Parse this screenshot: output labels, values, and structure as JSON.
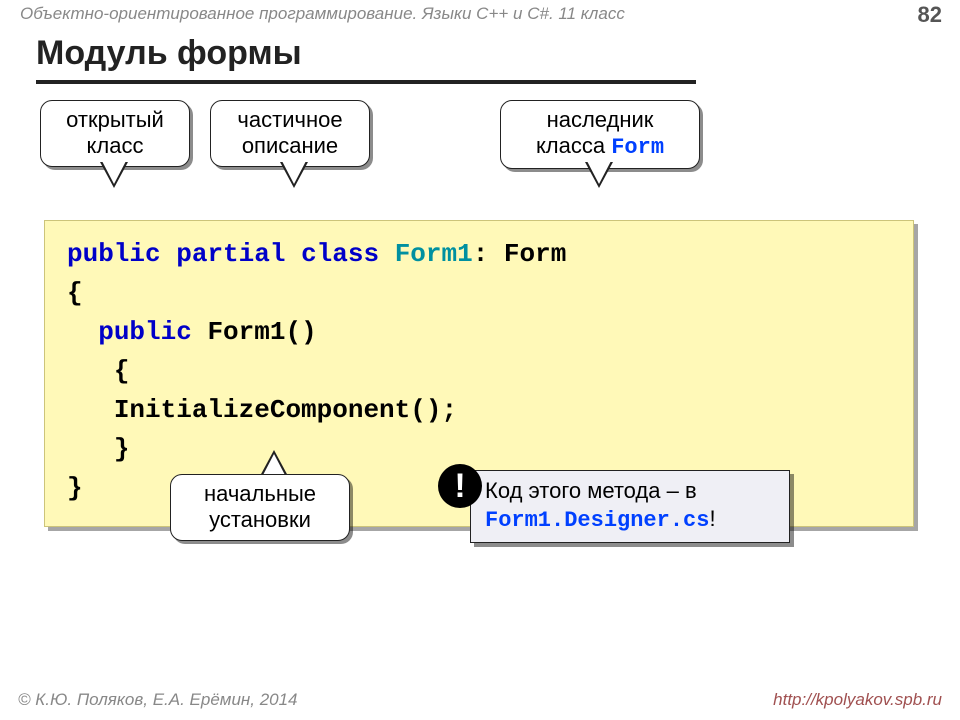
{
  "header": {
    "course": "Объектно-ориентированное программирование. Языки C++ и C#. 11 класс",
    "page": "82"
  },
  "title": "Модуль формы",
  "callouts": {
    "c1": {
      "line1": "открытый",
      "line2": "класс"
    },
    "c2": {
      "line1": "частичное",
      "line2": "описание"
    },
    "c3": {
      "line1": "наследник",
      "line2_a": "класса ",
      "line2_b": "Form"
    },
    "c4": {
      "line1": "начальные",
      "line2": "установки"
    }
  },
  "code": {
    "kw_public": "public",
    "kw_partial": "partial",
    "kw_class": "class",
    "typ_form1": "Form1",
    "base": ": Form",
    "brace_open": "{",
    "ctor_kw": "public",
    "ctor_name": "Form1()",
    "inner_open": "{",
    "init": "InitializeComponent();",
    "inner_close": "}",
    "brace_close": "}"
  },
  "note": {
    "line1": "Код этого метода – в",
    "file": "Form1.Designer.cs",
    "bang_text": "!",
    "trailing": "!"
  },
  "footer": {
    "left": "© К.Ю. Поляков, Е.А. Ерёмин, 2014",
    "right": "http://kpolyakov.spb.ru"
  }
}
